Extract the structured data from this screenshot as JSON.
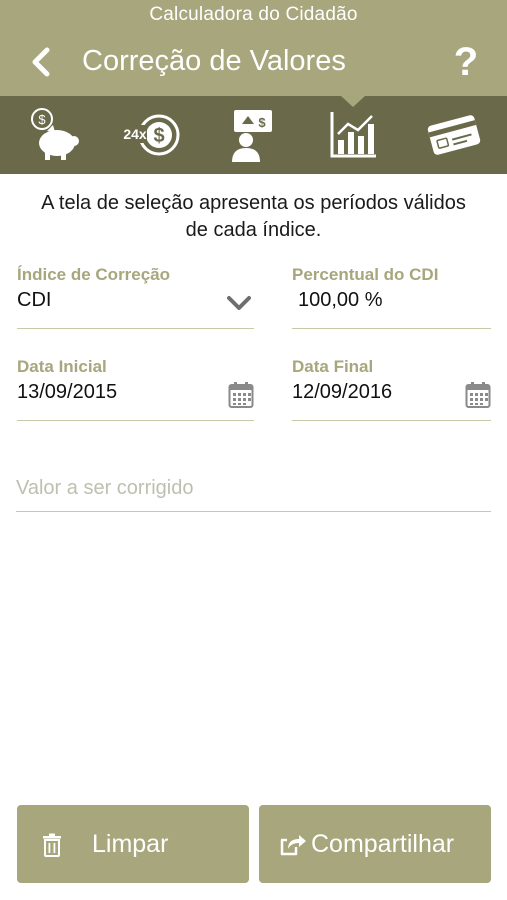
{
  "status": {
    "title": "Calculadora do Cidadão"
  },
  "header": {
    "title": "Correção de Valores",
    "help_label": "?"
  },
  "tabs": [
    {
      "icon": "piggy-bank-icon"
    },
    {
      "icon": "installments-24x-icon"
    },
    {
      "icon": "person-presentation-icon"
    },
    {
      "icon": "chart-growth-icon"
    },
    {
      "icon": "credit-card-icon"
    }
  ],
  "info": {
    "text": "A tela de seleção apresenta os períodos válidos de cada índice."
  },
  "form": {
    "indice": {
      "label": "Índice de Correção",
      "value": "CDI"
    },
    "percentual": {
      "label": "Percentual do CDI",
      "value": "100,00 %"
    },
    "data_inicial": {
      "label": "Data Inicial",
      "value": "13/09/2015"
    },
    "data_final": {
      "label": "Data Final",
      "value": "12/09/2016"
    },
    "valor": {
      "placeholder": "Valor a ser corrigido"
    }
  },
  "buttons": {
    "limpar": "Limpar",
    "compartilhar": "Compartilhar"
  },
  "colors": {
    "header": "#a7a67c",
    "tabbar": "#6a6a4b",
    "accent_label": "#a7a67c",
    "divider": "#c9c9a7"
  }
}
